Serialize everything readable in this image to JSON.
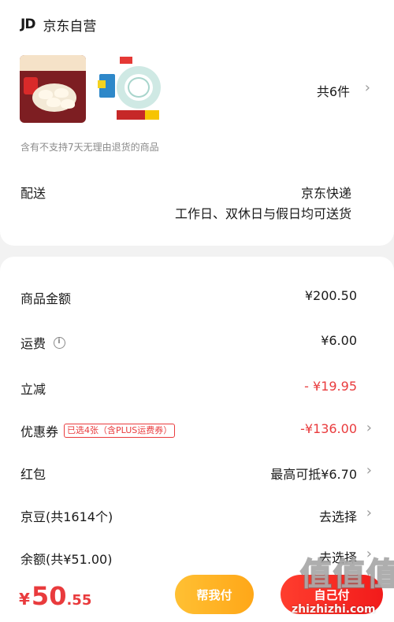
{
  "store": {
    "logo": "JD",
    "name": "京东自营"
  },
  "products": {
    "count_label": "共6件"
  },
  "notice": "含有不支持7天无理由退货的商品",
  "shipping": {
    "label": "配送",
    "carrier": "京东快递",
    "note": "工作日、双休日与假日均可送货"
  },
  "summary": {
    "goods_amount": {
      "label": "商品金额",
      "value": "¥200.50"
    },
    "freight": {
      "label": "运费",
      "value": "¥6.00"
    },
    "instant_discount": {
      "label": "立减",
      "value": "- ¥19.95"
    },
    "coupon": {
      "label": "优惠券",
      "tag": "已选4张（含PLUS运费券）",
      "value": "-¥136.00"
    },
    "red_packet": {
      "label": "红包",
      "value": "最高可抵¥6.70"
    },
    "jd_beans": {
      "label": "京豆(共1614个)",
      "value": "去选择"
    },
    "balance": {
      "label": "余额(共¥51.00)",
      "value": "去选择"
    }
  },
  "footer": {
    "currency": "¥",
    "price_int": "50",
    "price_dec": ".55",
    "help_pay_button": "帮我付",
    "pay_button": "自己付"
  },
  "watermark": {
    "chars": [
      "值",
      "值",
      "值"
    ],
    "url": "zhizhizhi.com"
  },
  "colors": {
    "accent_red": "#e93b3d",
    "help_button": "#ffb326",
    "pay_button": "#f52a24"
  }
}
